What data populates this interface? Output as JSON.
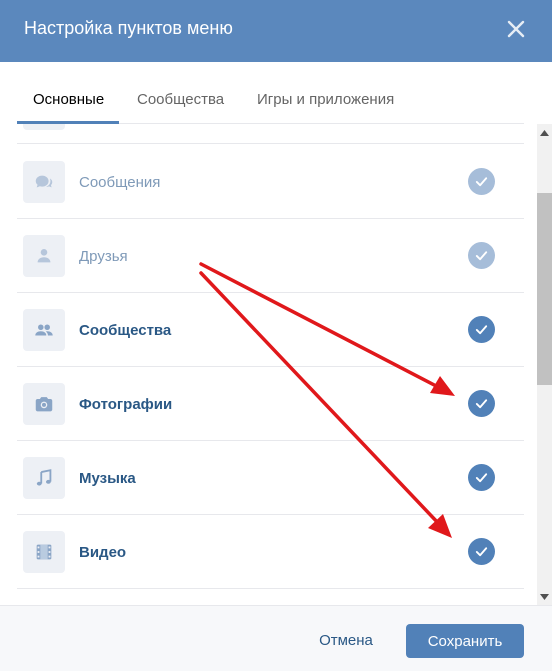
{
  "dialog": {
    "title": "Настройка пунктов меню"
  },
  "tabs": [
    {
      "label": "Основные",
      "active": true
    },
    {
      "label": "Сообщества",
      "active": false
    },
    {
      "label": "Игры и приложения",
      "active": false
    }
  ],
  "menu_items": [
    {
      "label": "Сообщения",
      "icon": "message-icon",
      "checked": true,
      "disabled": true
    },
    {
      "label": "Друзья",
      "icon": "person-icon",
      "checked": true,
      "disabled": true
    },
    {
      "label": "Сообщества",
      "icon": "group-icon",
      "checked": true,
      "disabled": false
    },
    {
      "label": "Фотографии",
      "icon": "camera-icon",
      "checked": true,
      "disabled": false
    },
    {
      "label": "Музыка",
      "icon": "music-note-icon",
      "checked": true,
      "disabled": false
    },
    {
      "label": "Видео",
      "icon": "video-film-icon",
      "checked": true,
      "disabled": false
    }
  ],
  "footer": {
    "cancel_label": "Отмена",
    "save_label": "Сохранить"
  },
  "colors": {
    "header": "#5b88bd",
    "accent": "#5181b8",
    "annotation_arrow": "#e0181b"
  }
}
